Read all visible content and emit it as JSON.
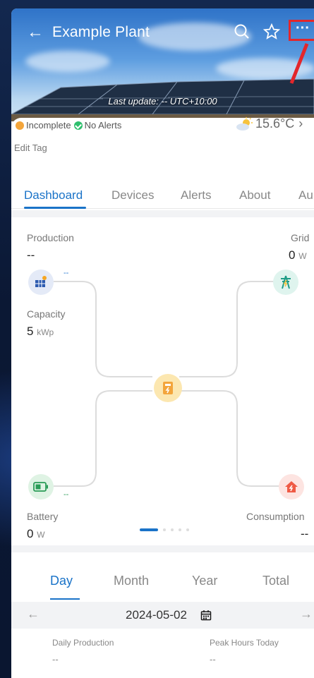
{
  "header": {
    "title": "Example Plant",
    "last_update": "Last update: -- UTC+10:00",
    "more_label": "···"
  },
  "status": {
    "state": "Incomplete",
    "alerts": "No Alerts",
    "temperature": "15.6°C",
    "edit_tag": "Edit Tag"
  },
  "tabs": [
    {
      "label": "Dashboard",
      "active": true
    },
    {
      "label": "Devices"
    },
    {
      "label": "Alerts"
    },
    {
      "label": "About"
    },
    {
      "label": "Au"
    }
  ],
  "flow": {
    "production": {
      "label": "Production",
      "value": "--",
      "mini": "--"
    },
    "grid": {
      "label": "Grid",
      "value": "0",
      "unit": "W"
    },
    "capacity": {
      "label": "Capacity",
      "value": "5",
      "unit": "kWp"
    },
    "battery": {
      "label": "Battery",
      "value": "0",
      "unit": "W",
      "mini": "--"
    },
    "consumption": {
      "label": "Consumption",
      "value": "--"
    }
  },
  "period_tabs": [
    {
      "label": "Day",
      "active": true
    },
    {
      "label": "Month"
    },
    {
      "label": "Year"
    },
    {
      "label": "Total"
    }
  ],
  "date": {
    "value": "2024-05-02",
    "prev": "←",
    "next": "→"
  },
  "stats": {
    "daily_production": {
      "label": "Daily Production",
      "value": "--"
    },
    "peak_hours": {
      "label": "Peak Hours Today",
      "value": "--"
    }
  },
  "colors": {
    "accent": "#1a73c8",
    "highlight": "#e3262b",
    "warning": "#f3a53b",
    "ok": "#2fbf6d"
  }
}
